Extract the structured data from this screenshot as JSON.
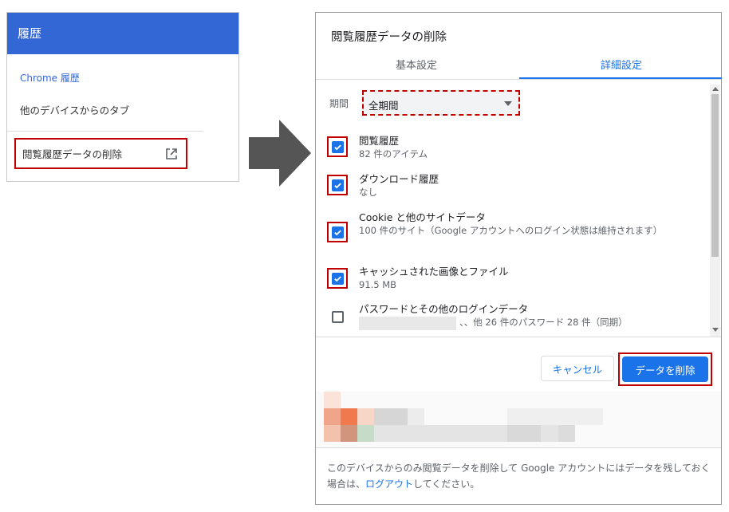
{
  "history_panel": {
    "header": "履歴",
    "chrome_history": "Chrome 履歴",
    "other_devices": "他のデバイスからのタブ",
    "clear_data": "閲覧履歴データの削除"
  },
  "dialog": {
    "title": "閲覧履歴データの削除",
    "tabs": [
      {
        "label": "基本設定",
        "active": false
      },
      {
        "label": "詳細設定",
        "active": true
      }
    ],
    "period": {
      "label": "期間",
      "value": "全期間"
    },
    "options": [
      {
        "title": "閲覧履歴",
        "desc": "82 件のアイテム",
        "checked": true
      },
      {
        "title": "ダウンロード履歴",
        "desc": "なし",
        "checked": true
      },
      {
        "title": "Cookie と他のサイトデータ",
        "desc": "100 件のサイト（Google アカウントへのログイン状態は維持されます）",
        "checked": true
      },
      {
        "title": "キャッシュされた画像とファイル",
        "desc": "91.5 MB",
        "checked": true
      },
      {
        "title": "パスワードとその他のログインデータ",
        "desc": "、、他 26 件のパスワード 28 件（同期）",
        "checked": false
      }
    ],
    "cancel_label": "キャンセル",
    "delete_label": "データを削除",
    "footer_text": "このデバイスからのみ閲覧データを削除して Google アカウントにはデータを残しておく場合は、",
    "footer_link": "ログアウト",
    "footer_suffix": "してください。"
  },
  "colors": {
    "accent": "#1a73e8",
    "header_blue": "#3367d6",
    "highlight_red": "#c00000",
    "arrow_gray": "#555555"
  },
  "icons": {
    "external": "external-link-icon",
    "check": "checkmark-icon",
    "dropdown": "dropdown-caret-icon",
    "arrow": "right-arrow-icon"
  }
}
